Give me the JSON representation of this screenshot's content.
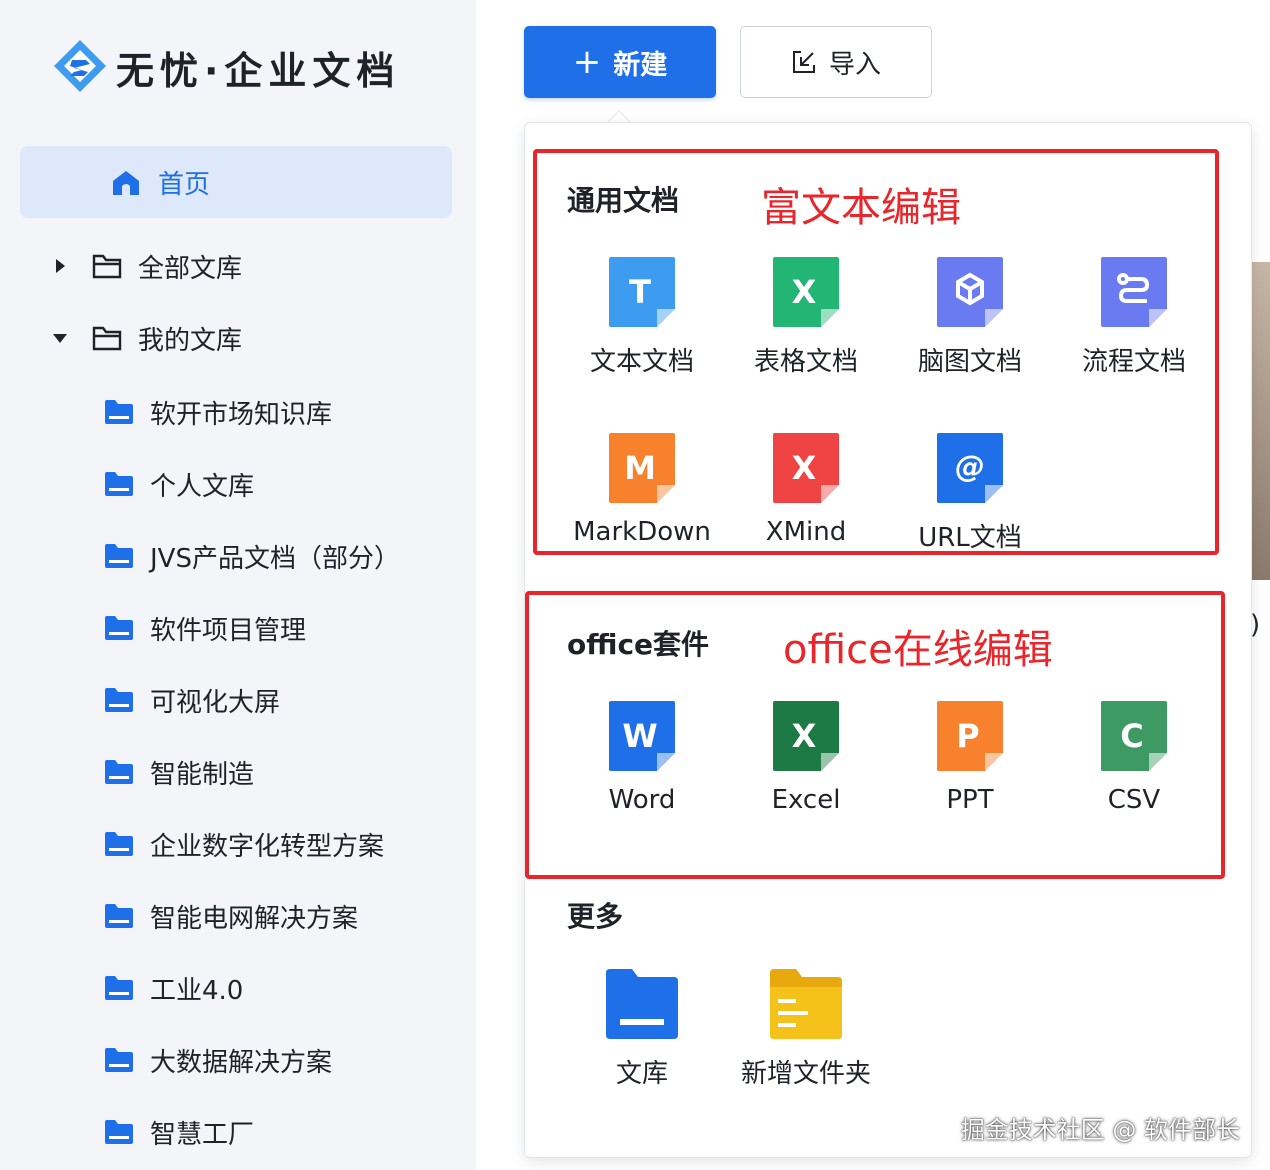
{
  "app": {
    "logo_text": "无忧·企业文档",
    "brand_color": "#1f6fe8",
    "logo_icon": "diamond-s-logo-icon"
  },
  "sidebar": {
    "home": {
      "label": "首页",
      "icon": "home-icon",
      "active": true
    },
    "groups": [
      {
        "label": "全部文库",
        "expanded": false,
        "icon": "folder-outline-icon"
      },
      {
        "label": "我的文库",
        "expanded": true,
        "icon": "folder-outline-icon"
      }
    ],
    "libraries": [
      {
        "label": "软开市场知识库"
      },
      {
        "label": "个人文库"
      },
      {
        "label": "JVS产品文档（部分）"
      },
      {
        "label": "软件项目管理"
      },
      {
        "label": "可视化大屏"
      },
      {
        "label": "智能制造"
      },
      {
        "label": "企业数字化转型方案"
      },
      {
        "label": "智能电网解决方案"
      },
      {
        "label": "工业4.0"
      },
      {
        "label": "大数据解决方案"
      },
      {
        "label": "智慧工厂"
      }
    ]
  },
  "toolbar": {
    "new_label": "新建",
    "new_icon": "plus-icon",
    "import_label": "导入",
    "import_icon": "import-icon"
  },
  "menu": {
    "general": {
      "title": "通用文档",
      "annotation": "富文本编辑",
      "items": [
        {
          "label": "文本文档",
          "icon": "text-doc-icon",
          "color": "#3d9bf0",
          "glyph": "T"
        },
        {
          "label": "表格文档",
          "icon": "sheet-doc-icon",
          "color": "#22b573",
          "glyph": "X"
        },
        {
          "label": "脑图文档",
          "icon": "mindmap-doc-icon",
          "color": "#6a7af0",
          "glyph": ""
        },
        {
          "label": "流程文档",
          "icon": "flow-doc-icon",
          "color": "#6a7af0",
          "glyph": ""
        },
        {
          "label": "MarkDown",
          "icon": "markdown-doc-icon",
          "color": "#f7812c",
          "glyph": "M"
        },
        {
          "label": "XMind",
          "icon": "xmind-doc-icon",
          "color": "#f04343",
          "glyph": "X"
        },
        {
          "label": "URL文档",
          "icon": "url-doc-icon",
          "color": "#1f6fe8",
          "glyph": "@"
        }
      ]
    },
    "office": {
      "title": "office套件",
      "annotation": "office在线编辑",
      "items": [
        {
          "label": "Word",
          "icon": "word-doc-icon",
          "color": "#1f6fe8",
          "glyph": "W"
        },
        {
          "label": "Excel",
          "icon": "excel-doc-icon",
          "color": "#1e7a45",
          "glyph": "X"
        },
        {
          "label": "PPT",
          "icon": "ppt-doc-icon",
          "color": "#f7812c",
          "glyph": "P"
        },
        {
          "label": "CSV",
          "icon": "csv-doc-icon",
          "color": "#3c9a62",
          "glyph": "C"
        }
      ]
    },
    "more": {
      "title": "更多",
      "items": [
        {
          "label": "文库",
          "icon": "library-folder-icon",
          "color": "#1f6fe8"
        },
        {
          "label": "新增文件夹",
          "icon": "new-folder-icon",
          "color": "#f5c21b"
        }
      ]
    }
  },
  "watermark": "掘金技术社区 @ 软件部长",
  "annotation_color": "#e8262b"
}
